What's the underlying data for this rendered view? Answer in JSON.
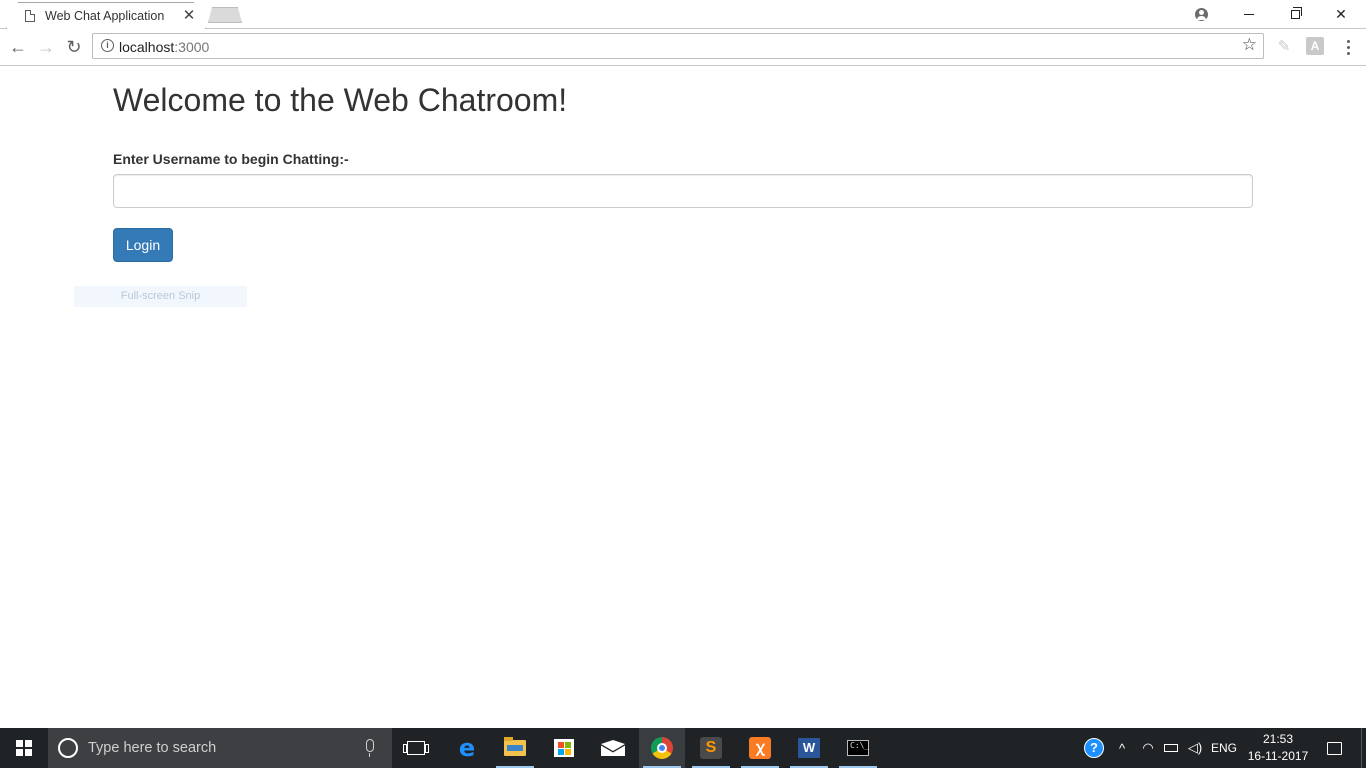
{
  "browser": {
    "tab_title": "Web Chat Application",
    "tab_close": "✕",
    "url_host": "localhost",
    "url_port": ":3000",
    "star": "☆",
    "window_min": "",
    "window_close": "✕"
  },
  "nav": {
    "back": "←",
    "forward": "→",
    "reload": "↻"
  },
  "page": {
    "heading": "Welcome to the Web Chatroom!",
    "username_label": "Enter Username to begin Chatting:-",
    "username_value": "",
    "login_label": "Login"
  },
  "overlay": {
    "snip_text": "Full-screen Snip"
  },
  "taskbar": {
    "search_placeholder": "Type here to search",
    "apps": [
      "task-view",
      "edge",
      "file-explorer",
      "store",
      "mail",
      "chrome",
      "sublime-text",
      "xampp",
      "word",
      "command-prompt"
    ],
    "tray": {
      "chevron": "^",
      "language": "ENG",
      "time": "21:53",
      "date": "16-11-2017"
    }
  },
  "colors": {
    "primary_button": "#337ab7",
    "taskbar": "#202326"
  }
}
